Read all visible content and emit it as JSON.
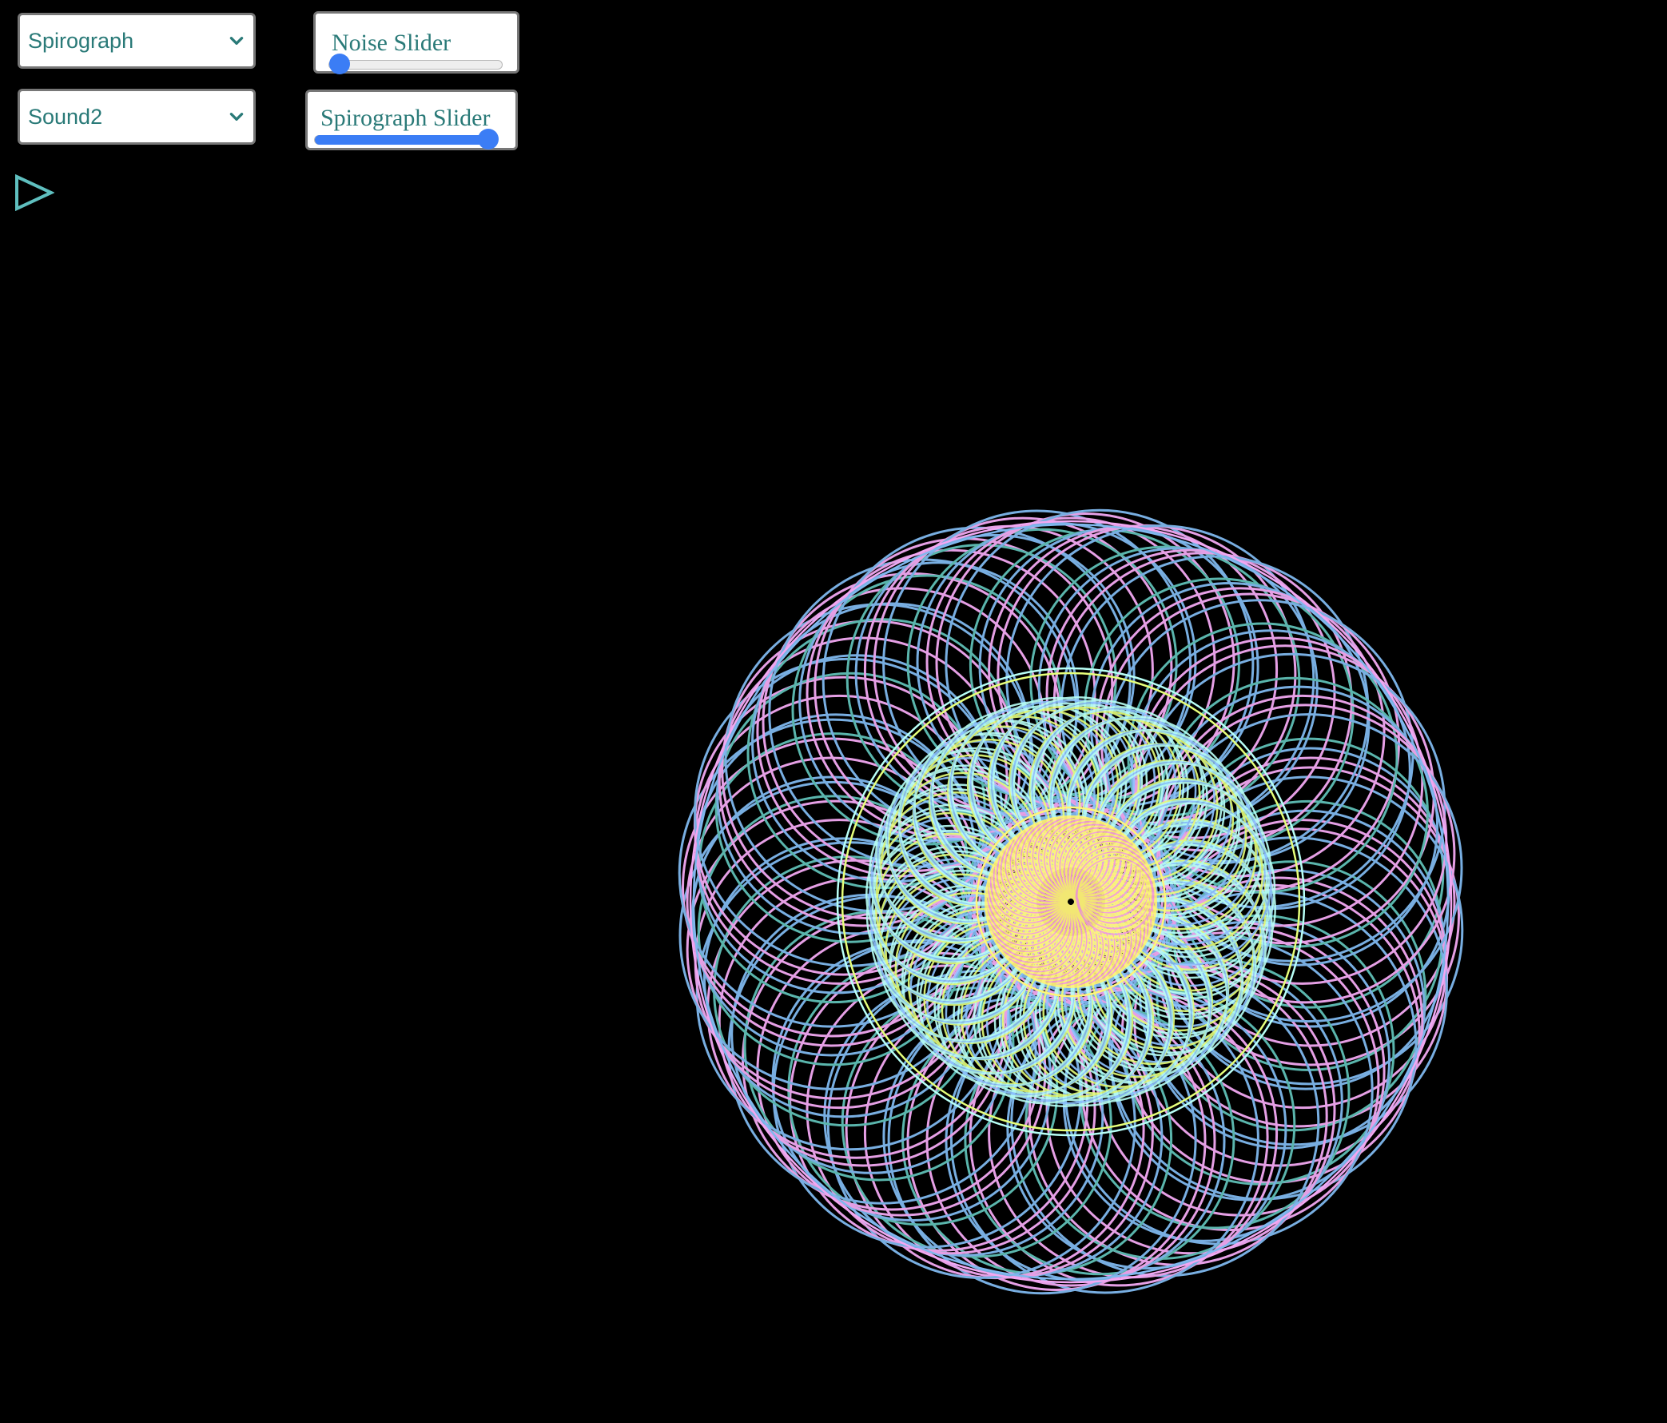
{
  "controls": {
    "mode_select": {
      "value": "Spirograph"
    },
    "sound_select": {
      "value": "Sound2"
    },
    "noise_slider": {
      "label": "Noise Slider",
      "value": 0.0
    },
    "spirograph_slider": {
      "label": "Spirograph Slider",
      "value": 1.0
    }
  },
  "play_button": {
    "icon": "play-icon"
  },
  "colors": {
    "background": "#000000",
    "control_text": "#2a7a78",
    "slider_accent": "#3b7df5",
    "play_icon": "#5fbfbf",
    "outer_pink": "#f2a8f2",
    "outer_blue": "#7fb8ee",
    "outer_teal": "#5fbfb6",
    "inner_cyan": "#b8fff6",
    "inner_lime": "#e6ff7a",
    "inner_blue": "#8ec4ff",
    "center_yellow": "#fff47a",
    "center_pink": "#f7a0d8"
  }
}
